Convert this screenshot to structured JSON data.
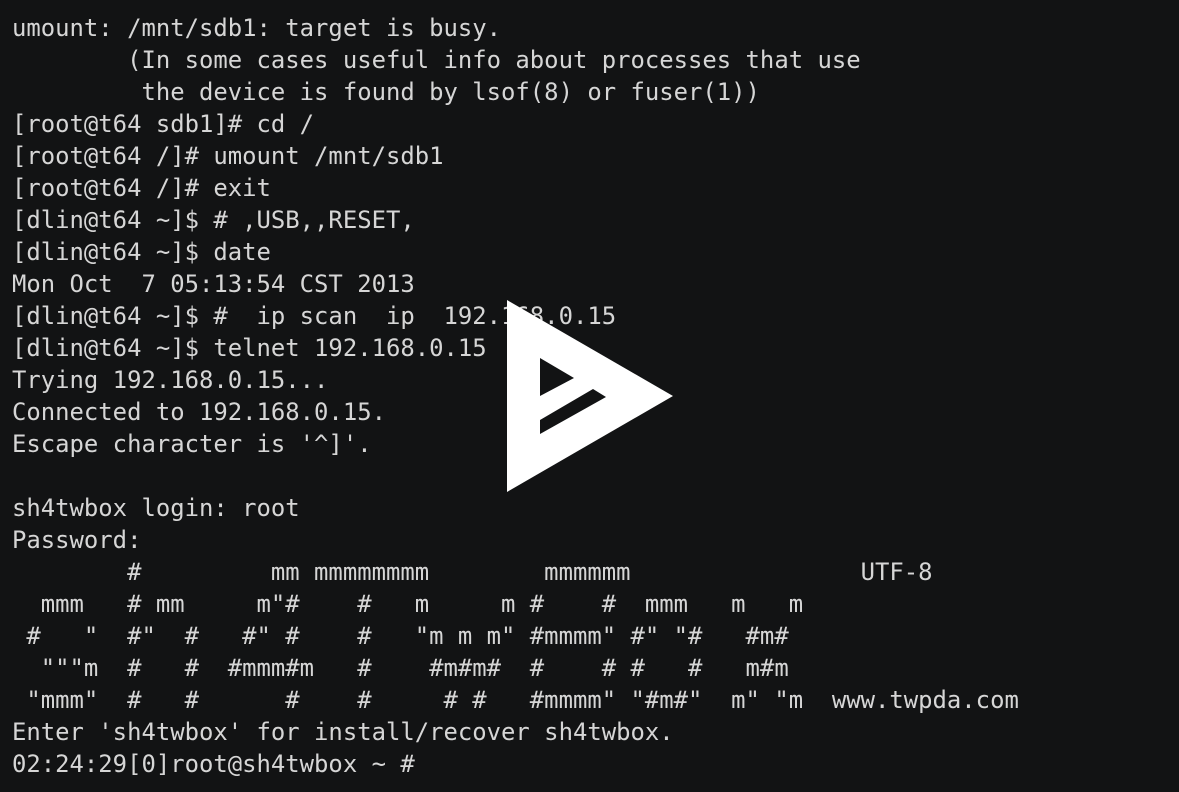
{
  "terminal": {
    "background": "#121314",
    "foreground": "#d6d6d6",
    "lines": [
      "umount: /mnt/sdb1: target is busy.",
      "        (In some cases useful info about processes that use",
      "         the device is found by lsof(8) or fuser(1))",
      "[root@t64 sdb1]# cd /",
      "[root@t64 /]# umount /mnt/sdb1",
      "[root@t64 /]# exit",
      "[dlin@t64 ~]$ # ,USB,,RESET,",
      "[dlin@t64 ~]$ date",
      "Mon Oct  7 05:13:54 CST 2013",
      "[dlin@t64 ~]$ #  ip scan  ip  192.168.0.15",
      "[dlin@t64 ~]$ telnet 192.168.0.15",
      "Trying 192.168.0.15...",
      "Connected to 192.168.0.15.",
      "Escape character is '^]'.",
      "",
      "sh4twbox login: root",
      "Password:",
      "        #         mm mmmmmmmm        mmmmmm                UTF-8",
      "  mmm   # mm     m\"#    #   m     m #    #  mmm   m   m",
      " #   \"  #\"  #   #\" #    #   \"m m m\" #mmmm\" #\" \"#   #m#",
      "  \"\"\"m  #   #  #mmm#m   #    #m#m#  #    # #   #   m#m",
      " \"mmm\"  #   #      #    #     # #   #mmmm\" \"#m#\"  m\" \"m  www.twpda.com",
      "Enter 'sh4twbox' for install/recover sh4twbox.",
      "02:24:29[0]root@sh4twbox ~ #"
    ]
  },
  "overlay": {
    "icon": "asciinema-play-icon",
    "color": "#ffffff"
  }
}
